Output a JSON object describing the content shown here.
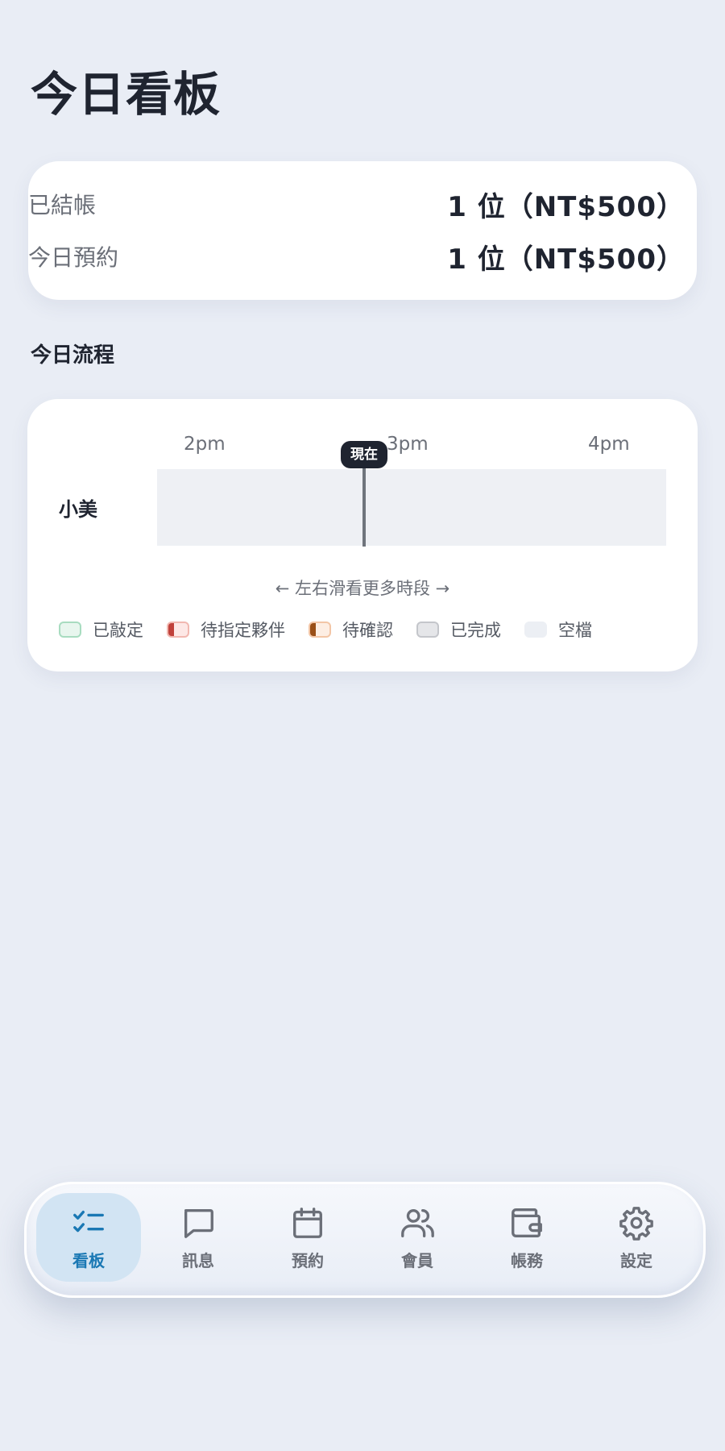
{
  "page": {
    "title": "今日看板"
  },
  "summary": {
    "checked_out": {
      "label": "已結帳",
      "value": "1 位（NT$500）"
    },
    "today_bookings": {
      "label": "今日預約",
      "value": "1 位（NT$500）"
    }
  },
  "flow": {
    "section_title": "今日流程",
    "ticks": [
      "2pm",
      "3pm",
      "4pm"
    ],
    "now_label": "現在",
    "staff": [
      {
        "name": "小美"
      }
    ],
    "scroll_hint": "← 左右滑看更多時段 →",
    "legend": [
      {
        "label": "已敲定",
        "status": "booked",
        "color": "#a8dcc0"
      },
      {
        "label": "待指定夥伴",
        "status": "pending-partner",
        "color": "#c0413b"
      },
      {
        "label": "待確認",
        "status": "pending-confirm",
        "color": "#9a4f17"
      },
      {
        "label": "已完成",
        "status": "done",
        "color": "#c4c6cb"
      },
      {
        "label": "空檔",
        "status": "empty",
        "color": "#eceff4"
      }
    ]
  },
  "nav": {
    "active_color": "#1a78b4",
    "items": [
      {
        "label": "看板",
        "icon": "checklist-icon",
        "active": true
      },
      {
        "label": "訊息",
        "icon": "chat-bubble-icon",
        "active": false
      },
      {
        "label": "預約",
        "icon": "calendar-icon",
        "active": false
      },
      {
        "label": "會員",
        "icon": "users-icon",
        "active": false
      },
      {
        "label": "帳務",
        "icon": "wallet-icon",
        "active": false
      },
      {
        "label": "設定",
        "icon": "gear-icon",
        "active": false
      }
    ]
  }
}
